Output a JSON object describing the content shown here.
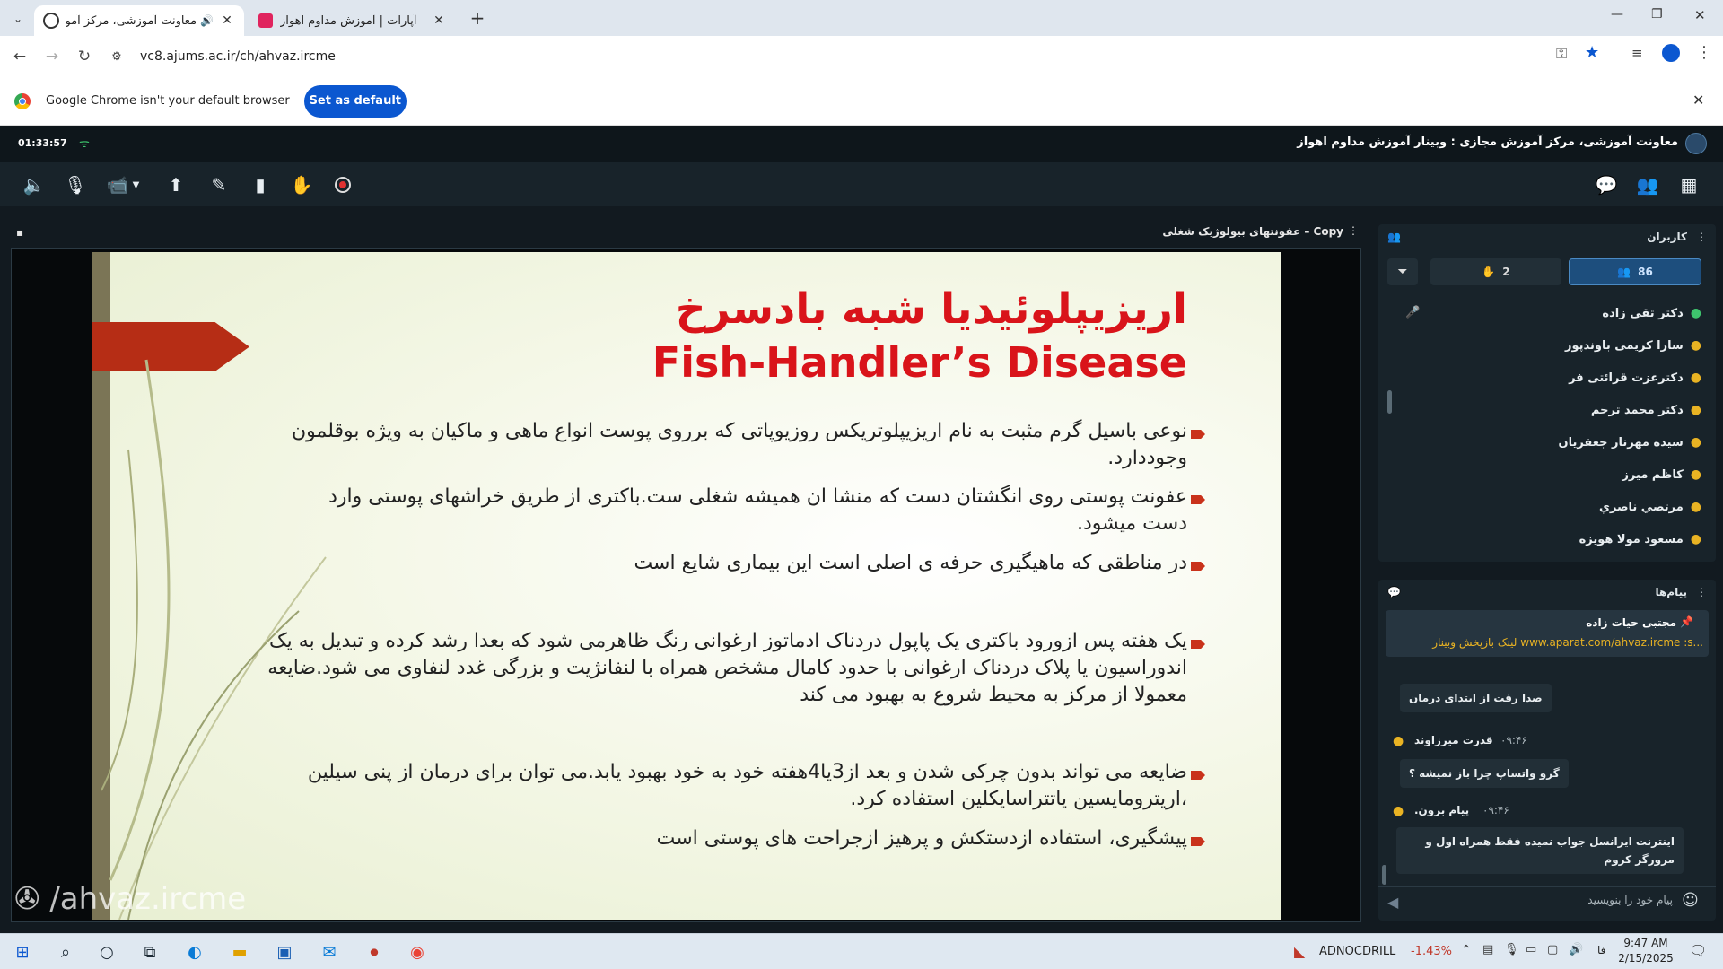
{
  "browser": {
    "tabs": [
      {
        "title": "معاونت آموزشی، مرکز آموزش",
        "active": true
      },
      {
        "title": "آپارات | آموزش مداوم اهواز",
        "active": false
      }
    ],
    "url": "vc8.ajums.ac.ir/ch/ahvaz.ircme",
    "infobar": {
      "message": "Google Chrome isn't your default browser",
      "button": "Set as default"
    }
  },
  "app": {
    "elapsed": "01:33:57",
    "room_title": "معاونت آموزشی، مرکز آموزش مجازی : وبینار آموزش مداوم اهواز",
    "stage_title": "عفونتهای بیولوژیک شغلی – Copy",
    "watermark": "/ahvaz.ircme"
  },
  "slide": {
    "title_fa": "اریزیپلوئیدیا شبه بادسرخ",
    "title_en": "Fish-Handler’s Disease",
    "bullets": [
      "نوعی باسیل گرم مثبت به نام اریزیپلوتریکس روزیوپاتی که برروی پوست انواع ماهی و ماکیان به ویژه بوقلمون وجوددارد.",
      "عفونت پوستی روی انگشتان دست که منشا ان همیشه شغلی ست.باکتری از طریق خراشهای پوستی وارد دست میشود.",
      "در مناطقی که ماهیگیری حرفه ی اصلی است این بیماری شایع است",
      "یک هفته پس ازورود باکتری یک پاپول دردناک ادماتوز ارغوانی رنگ ظاهرمی شود که بعدا رشد کرده و تبدیل به یک اندوراسیون یا پلاک دردناک ارغوانی با حدود کامال مشخص همراه با لنفانژیت و بزرگی غدد لنفاوی می شود.ضایعه معمولا از مرکز به محیط شروع به بهبود می کند",
      "ضایعه می تواند بدون چرکی شدن و بعد از3یا4هفته خود به خود بهبود یابد.می توان برای درمان از پنی سیلین ،اریترومایسین یاتتراسایکلین استفاده کرد.",
      "پیشگیری، استفاده ازدستکش و پرهیز ازجراحت های پوستی است"
    ]
  },
  "users_panel": {
    "title": "کاربران",
    "count_all": "86",
    "count_hands": "2",
    "users": [
      "دکتر تقی زاده",
      "سارا کریمی باوندپور",
      "دکترعزت قرائتی فر",
      "دکتر محمد ترحم",
      "سیده مهرناز جعفریان",
      "کاظم میرز",
      "مرتضي ناصري",
      "مسعود مولا هویزه"
    ]
  },
  "messages_panel": {
    "title": "پیام‌ها",
    "pinned_author": "مجتبی حیات زاده",
    "pinned_text": "لینک بازپخش وبینار www.aparat.com/ahvaz.ircme :s...",
    "messages": [
      {
        "text": "صدا رفت از ابتدای درمان"
      },
      {
        "author": "قدرت میرزاوند",
        "time": "۰۹:۴۶",
        "text": "گرو واتساپ چرا باز نمیشه ؟"
      },
      {
        "author": "پیام برون.",
        "time": "۰۹:۴۶",
        "text": "اینترنت ایرانسل جواب نمیده فقط همراه اول و مرورگر کروم"
      }
    ],
    "input_placeholder": "پیام خود را بنویسید"
  },
  "taskbar": {
    "stock_name": "ADNOCDRILL",
    "stock_change": "-1.43%",
    "lang": "فا",
    "time": "9:47 AM",
    "date": "2/15/2025"
  },
  "colors": {
    "accent": "#0b57d0",
    "title_red": "#d9141a",
    "user_icon": "#e9b323",
    "active_tab_btn": "#1d4e7d"
  }
}
